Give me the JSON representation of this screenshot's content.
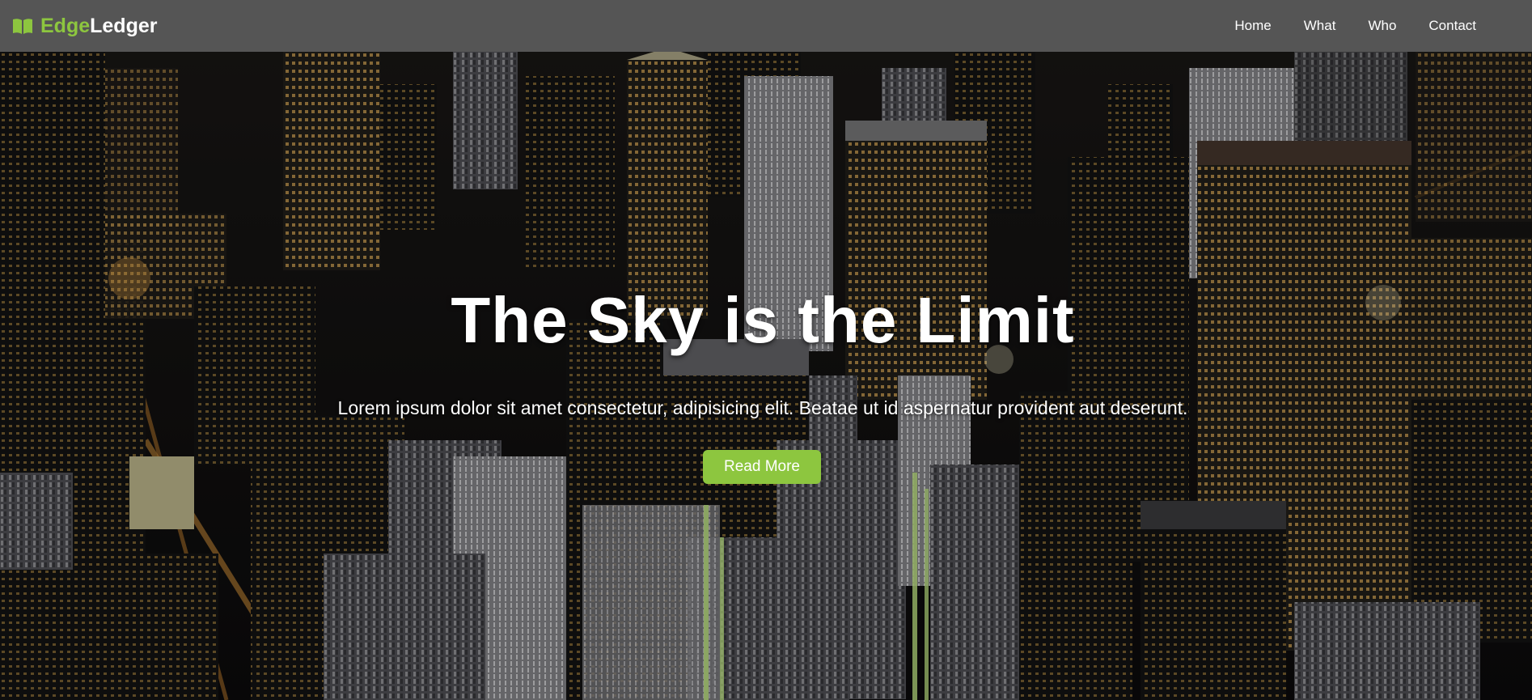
{
  "brand": {
    "icon": "open-book-icon",
    "name_accent": "Edge",
    "name_rest": "Ledger",
    "accent_color": "#8dc63f"
  },
  "nav": {
    "links": [
      {
        "label": "Home"
      },
      {
        "label": "What"
      },
      {
        "label": "Who"
      },
      {
        "label": "Contact"
      }
    ],
    "background_color": "#555555"
  },
  "hero": {
    "background": "aerial-night-city-skyline-image",
    "title": "The Sky is the Limit",
    "text": "Lorem ipsum dolor sit amet consectetur, adipisicing elit. Beatae ut id aspernatur provident aut deserunt.",
    "button_label": "Read More",
    "button_color": "#8dc63f"
  }
}
